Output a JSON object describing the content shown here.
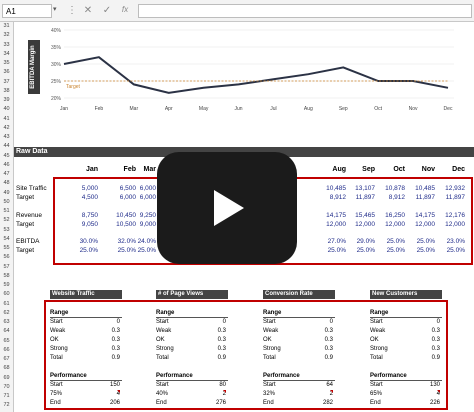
{
  "formula_bar": {
    "name_box": "A1",
    "name_icon": "chevron-down-icon",
    "icons": [
      "more-icon",
      "cancel-icon",
      "confirm-icon",
      "fx-icon"
    ],
    "icon_glyphs": [
      "⋮",
      "✕",
      "✓",
      "fx"
    ]
  },
  "row_numbers": [
    "31",
    "32",
    "33",
    "34",
    "35",
    "36",
    "37",
    "38",
    "39",
    "40",
    "41",
    "42",
    "43",
    "44",
    "45",
    "46",
    "47",
    "48",
    "49",
    "50",
    "51",
    "52",
    "53",
    "54",
    "55",
    "56",
    "57",
    "58",
    "59",
    "60",
    "61",
    "62",
    "63",
    "64",
    "65",
    "66",
    "67",
    "68",
    "69",
    "70",
    "71",
    "72"
  ],
  "chart_data": {
    "type": "line",
    "ylabel": "EBITDA Margin",
    "categories": [
      "Jan",
      "Feb",
      "Mar",
      "Apr",
      "May",
      "Jun",
      "Jul",
      "Aug",
      "Sep",
      "Oct",
      "Nov",
      "Dec"
    ],
    "y_ticks": [
      "40%",
      "35%",
      "30%",
      "25%",
      "20%"
    ],
    "ylim": [
      20,
      40
    ],
    "series": [
      {
        "values": [
          30.0,
          32.0,
          24.0,
          21.5,
          23.0,
          24.0,
          25.5,
          27.0,
          29.0,
          25.0,
          25.0,
          23.0
        ],
        "color": "#2b3245"
      },
      {
        "name": "Target",
        "values": [
          25,
          25,
          25,
          25,
          25,
          25,
          25,
          25,
          25,
          25,
          25,
          25
        ],
        "color": "#c9832e",
        "dashed": true
      }
    ]
  },
  "raw_data": {
    "title": "Raw Data",
    "months": [
      "Jan",
      "Feb",
      "Mar",
      "Aug",
      "Sep",
      "Oct",
      "Nov",
      "Dec"
    ],
    "row_labels": [
      "Site Traffic",
      "Target",
      "Revenue",
      "Target",
      "EBITDA",
      "Target"
    ],
    "rows": [
      [
        "5,000",
        "6,500",
        "6,000",
        "10,485",
        "13,107",
        "10,878",
        "10,485",
        "12,932"
      ],
      [
        "4,500",
        "6,000",
        "6,000",
        "8,912",
        "11,897",
        "8,912",
        "11,897",
        "11,897"
      ],
      [
        "8,750",
        "10,450",
        "9,250",
        "14,175",
        "15,465",
        "16,250",
        "14,175",
        "12,176"
      ],
      [
        "9,050",
        "10,500",
        "9,000",
        "12,000",
        "12,000",
        "12,000",
        "12,000",
        "12,000"
      ],
      [
        "30.0%",
        "32.0%",
        "24.0%",
        "27.0%",
        "29.0%",
        "25.0%",
        "25.0%",
        "23.0%"
      ],
      [
        "25.0%",
        "25.0%",
        "25.0%",
        "25.0%",
        "25.0%",
        "25.0%",
        "25.0%",
        "25.0%"
      ]
    ]
  },
  "panels": [
    {
      "title": "Website Traffic",
      "range": "Range",
      "labels": [
        "Start",
        "Weak",
        "OK",
        "Strong",
        "Total"
      ],
      "values": [
        "0",
        "0.3",
        "0.3",
        "0.3",
        "0.9"
      ],
      "perf": "Performance",
      "perf_labels": [
        "Start",
        "75%",
        "End"
      ],
      "perf_values": [
        "150",
        "4",
        "206"
      ]
    },
    {
      "title": "# of Page Views",
      "range": "Range",
      "labels": [
        "Start",
        "Weak",
        "OK",
        "Strong",
        "Total"
      ],
      "values": [
        "0",
        "0.3",
        "0.3",
        "0.3",
        "0.9"
      ],
      "perf": "Performance",
      "perf_labels": [
        "Start",
        "40%",
        "End"
      ],
      "perf_values": [
        "80",
        "2",
        "276"
      ]
    },
    {
      "title": "Conversion Rate",
      "range": "Range",
      "labels": [
        "Start",
        "Weak",
        "OK",
        "Strong",
        "Total"
      ],
      "values": [
        "0",
        "0.3",
        "0.3",
        "0.3",
        "0.9"
      ],
      "perf": "Performance",
      "perf_labels": [
        "Start",
        "32%",
        "End"
      ],
      "perf_values": [
        "64",
        "2",
        "282"
      ]
    },
    {
      "title": "New Customers",
      "range": "Range",
      "labels": [
        "Start",
        "Weak",
        "OK",
        "Strong",
        "Total"
      ],
      "values": [
        "0",
        "0.3",
        "0.3",
        "0.3",
        "0.9"
      ],
      "perf": "Performance",
      "perf_labels": [
        "Start",
        "65%",
        "End"
      ],
      "perf_values": [
        "130",
        "4",
        "226"
      ]
    }
  ],
  "video_overlay": {
    "icon": "play-icon"
  }
}
